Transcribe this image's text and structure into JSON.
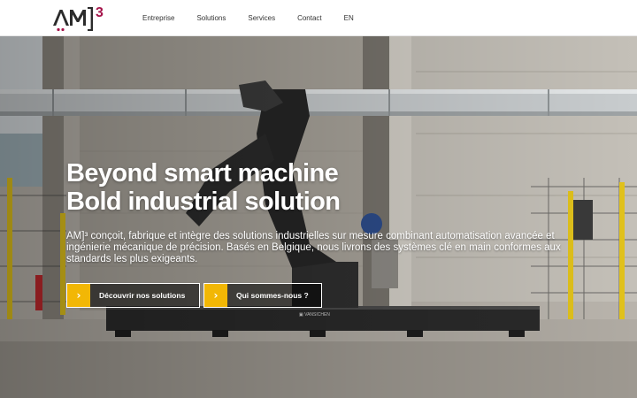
{
  "brand": {
    "name": "AM]³",
    "colors": {
      "dark": "#2b2b2b",
      "accent": "#a5144a",
      "cta_arrow": "#f2b705"
    }
  },
  "nav": {
    "items": [
      "Entreprise",
      "Solutions",
      "Services",
      "Contact"
    ],
    "language": "EN"
  },
  "hero": {
    "title_line1": "Beyond smart machine",
    "title_line2": "Bold industrial solution",
    "description": "AM]³ conçoit, fabrique et intègre des solutions industrielles sur mesure combinant automatisation avancée et ingénierie mécanique de précision. Basés en Belgique, nous livrons des systèmes clé en main conformes aux standards les plus exigeants.",
    "buttons": [
      {
        "label": "Découvrir nos solutions",
        "icon": "chevron-right-icon"
      },
      {
        "label": "Qui sommes-nous ?",
        "icon": "chevron-right-icon"
      }
    ],
    "background_image": "industrial robot arm in workshop"
  }
}
